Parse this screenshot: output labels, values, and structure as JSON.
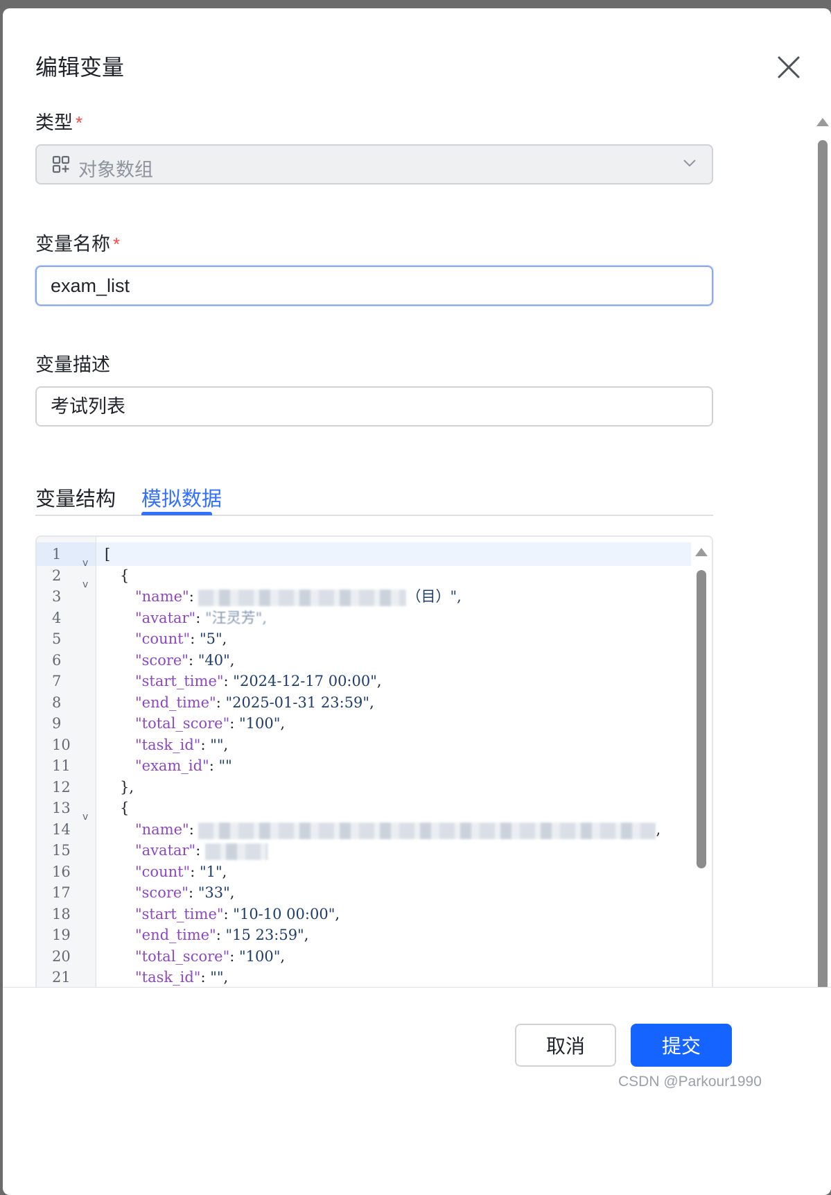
{
  "modal": {
    "title": "编辑变量"
  },
  "type_field": {
    "label": "类型",
    "required_mark": "*",
    "selected": "对象数组",
    "icon": "object-array-icon"
  },
  "name_field": {
    "label": "变量名称",
    "required_mark": "*",
    "value": "exam_list"
  },
  "desc_field": {
    "label": "变量描述",
    "value": "考试列表"
  },
  "tabs": [
    {
      "label": "变量结构",
      "active": false
    },
    {
      "label": "模拟数据",
      "active": true
    }
  ],
  "editor": {
    "lines": [
      {
        "n": "1",
        "fold": true
      },
      {
        "n": "2",
        "fold": true
      },
      {
        "n": "3"
      },
      {
        "n": "4"
      },
      {
        "n": "5"
      },
      {
        "n": "6"
      },
      {
        "n": "7"
      },
      {
        "n": "8"
      },
      {
        "n": "9"
      },
      {
        "n": "10"
      },
      {
        "n": "11"
      },
      {
        "n": "12"
      },
      {
        "n": "13",
        "fold": true
      },
      {
        "n": "14"
      },
      {
        "n": "15"
      },
      {
        "n": "16"
      },
      {
        "n": "17"
      },
      {
        "n": "18"
      },
      {
        "n": "19"
      },
      {
        "n": "20"
      },
      {
        "n": "21"
      }
    ],
    "code": {
      "l1": "[",
      "l2": "{",
      "l3_key": "\"name\"",
      "l3_tail": "（目）\",",
      "l4_key": "\"avatar\"",
      "l4_val": "\"汪灵芳\",",
      "l5_key": "\"count\"",
      "l5_val": "\"5\"",
      "l6_key": "\"score\"",
      "l6_val": "\"40\"",
      "l7_key": "\"start_time\"",
      "l7_val": "\"2024-12-17 00:00\"",
      "l8_key": "\"end_time\"",
      "l8_val": "\"2025-01-31 23:59\"",
      "l9_key": "\"total_score\"",
      "l9_val": "\"100\"",
      "l10_key": "\"task_id\"",
      "l10_val": "\"\"",
      "l11_key": "\"exam_id\"",
      "l11_val": "\"\"",
      "l12": "},",
      "l13": "{",
      "l14_key": "\"name\"",
      "l15_key": "\"avatar\"",
      "l16_key": "\"count\"",
      "l16_val": "\"1\"",
      "l17_key": "\"score\"",
      "l17_val": "\"33\"",
      "l18_key": "\"start_time\"",
      "l18_val": "\"10-10 00:00\"",
      "l19_key": "\"end_time\"",
      "l19_val": "\"15 23:59\"",
      "l20_key": "\"total_score\"",
      "l20_val": "\"100\"",
      "l21_key": "\"task_id\"",
      "l21_val": "\"\""
    }
  },
  "footer": {
    "cancel_label": "取消",
    "submit_label": "提交",
    "watermark": "CSDN @Parkour1990"
  },
  "colors": {
    "accent": "#1664ff",
    "required": "#f54a45",
    "json_key": "#8c47c2",
    "json_string": "#1c3d6e"
  }
}
